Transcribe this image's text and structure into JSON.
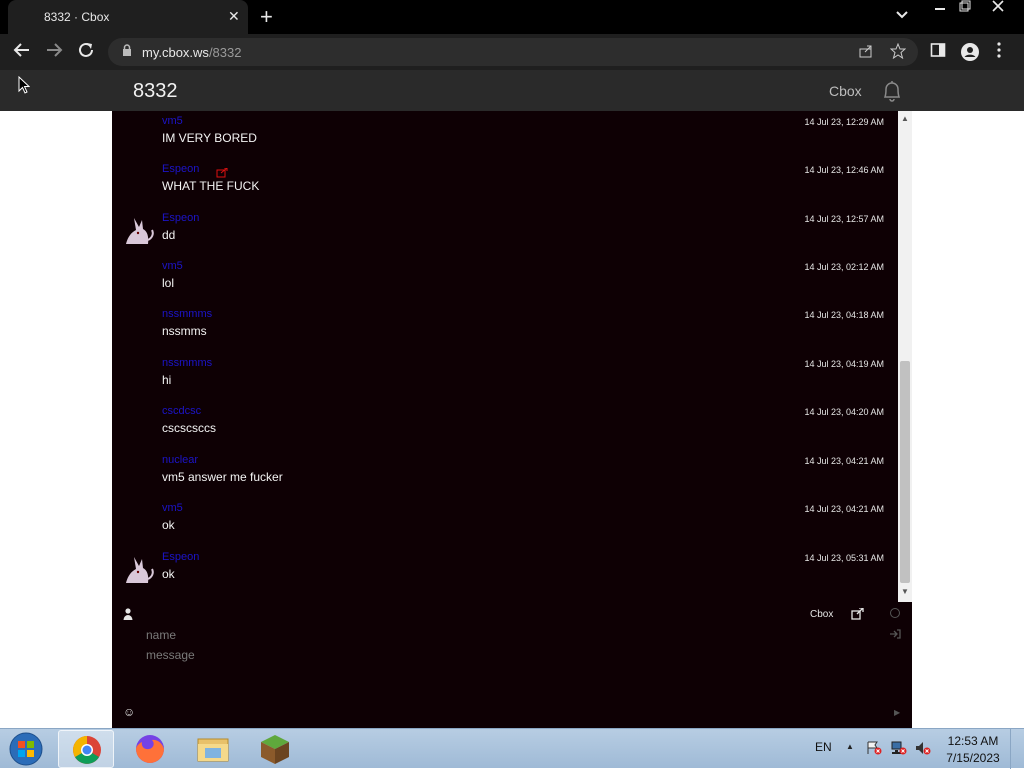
{
  "browser": {
    "tab_title": "8332 · Cbox",
    "tab_close": "✕",
    "new_tab": "+",
    "url_host": "my.cbox.ws",
    "url_path": "/8332"
  },
  "header": {
    "title": "8332",
    "cbox_link": "Cbox"
  },
  "messages": [
    {
      "user": "vm5",
      "text": "IM VERY BORED",
      "time": "14 Jul 23, 12:29 AM",
      "avatar": false,
      "ext_icon": false
    },
    {
      "user": "Espeon",
      "text": "WHAT THE FUCK",
      "time": "14 Jul 23, 12:46 AM",
      "avatar": false,
      "ext_icon": true
    },
    {
      "user": "Espeon",
      "text": "dd",
      "time": "14 Jul 23, 12:57 AM",
      "avatar": true,
      "ext_icon": false
    },
    {
      "user": "vm5",
      "text": "lol",
      "time": "14 Jul 23, 02:12 AM",
      "avatar": false,
      "ext_icon": false
    },
    {
      "user": "nssmmms",
      "text": "nssmms",
      "time": "14 Jul 23, 04:18 AM",
      "avatar": false,
      "ext_icon": false
    },
    {
      "user": "nssmmms",
      "text": "hi",
      "time": "14 Jul 23, 04:19 AM",
      "avatar": false,
      "ext_icon": false
    },
    {
      "user": "cscdcsc",
      "text": "cscscsccs",
      "time": "14 Jul 23, 04:20 AM",
      "avatar": false,
      "ext_icon": false
    },
    {
      "user": "nuclear",
      "text": "vm5 answer me fucker",
      "time": "14 Jul 23, 04:21 AM",
      "avatar": false,
      "ext_icon": false
    },
    {
      "user": "vm5",
      "text": "ok",
      "time": "14 Jul 23, 04:21 AM",
      "avatar": false,
      "ext_icon": false
    },
    {
      "user": "Espeon",
      "text": "ok",
      "time": "14 Jul 23, 05:31 AM",
      "avatar": true,
      "ext_icon": false
    }
  ],
  "form": {
    "cbox_label": "Cbox",
    "name_placeholder": "name",
    "message_placeholder": "message"
  },
  "taskbar": {
    "lang": "EN",
    "time": "12:53 AM",
    "date": "7/15/2023"
  },
  "colors": {
    "chat_bg": "#0e0004",
    "username": "#1c14c8",
    "header_bg": "#2a2a2a"
  }
}
